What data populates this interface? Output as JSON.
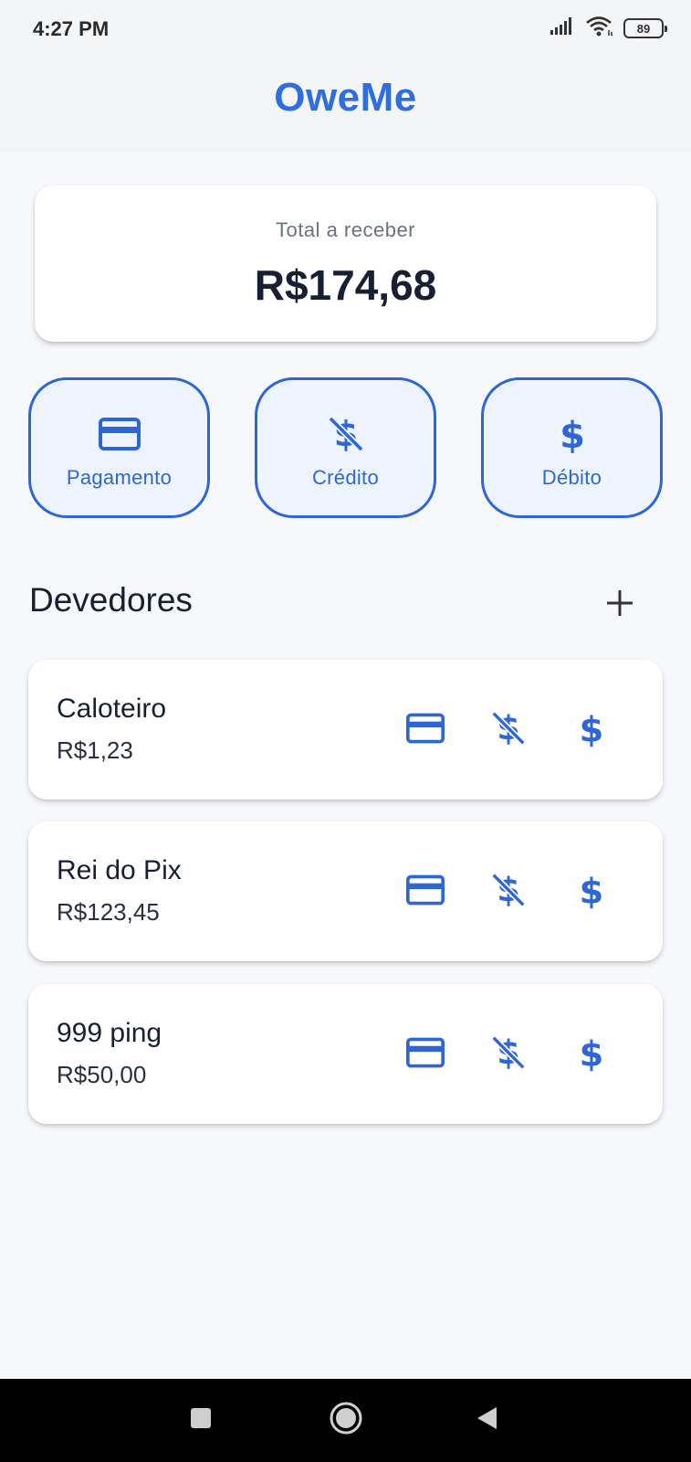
{
  "status_bar": {
    "time": "4:27 PM",
    "battery": "89",
    "icons": [
      "signal-icon",
      "wifi-icon",
      "battery-icon"
    ]
  },
  "header": {
    "title": "OweMe"
  },
  "summary": {
    "label": "Total a receber",
    "value": "R$174,68"
  },
  "actions": [
    {
      "label": "Pagamento",
      "icon": "credit-card-icon"
    },
    {
      "label": "Crédito",
      "icon": "money-off-icon"
    },
    {
      "label": "Débito",
      "icon": "dollar-icon"
    }
  ],
  "debtors_section": {
    "title": "Devedores",
    "add_icon": "plus-icon"
  },
  "debtors": [
    {
      "name": "Caloteiro",
      "amount": "R$1,23"
    },
    {
      "name": "Rei do Pix",
      "amount": "R$123,45"
    },
    {
      "name": "999 ping",
      "amount": "R$50,00"
    }
  ],
  "nav": [
    "recents-icon",
    "home-icon",
    "back-icon"
  ],
  "colors": {
    "accent": "#2f66d6",
    "title": "#2f6ee0",
    "background": "#f6f8fb",
    "button_fill": "#edf4ff"
  }
}
